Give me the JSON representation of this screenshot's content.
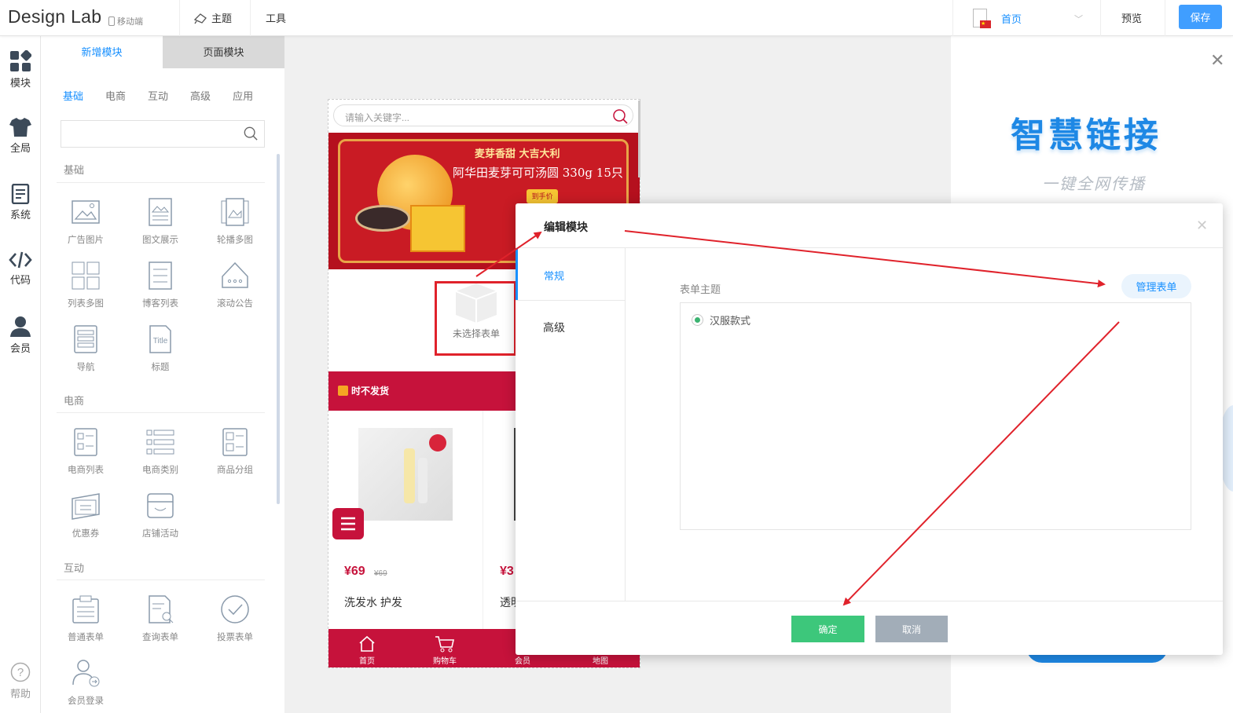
{
  "app": {
    "logo": "Design Lab",
    "device": "移动端"
  },
  "topbar": {
    "menu": [
      {
        "label": "主题",
        "icon": "theme-icon"
      },
      {
        "label": "工具"
      }
    ],
    "current_page": "首页",
    "preview": "预览",
    "save": "保存"
  },
  "sidebar": {
    "items": [
      {
        "label": "模块",
        "icon": "modules-icon"
      },
      {
        "label": "全局",
        "icon": "shirt-icon"
      },
      {
        "label": "系统",
        "icon": "document-icon"
      },
      {
        "label": "代码",
        "icon": "code-icon"
      },
      {
        "label": "会员",
        "icon": "user-icon"
      }
    ],
    "help": "帮助"
  },
  "panel": {
    "tabs": [
      "新增模块",
      "页面模块"
    ],
    "categories": [
      "基础",
      "电商",
      "互动",
      "高级",
      "应用"
    ],
    "sections": [
      {
        "title": "基础",
        "modules": [
          "广告图片",
          "图文展示",
          "轮播多图",
          "列表多图",
          "博客列表",
          "滚动公告",
          "导航",
          "标题"
        ]
      },
      {
        "title": "电商",
        "modules": [
          "电商列表",
          "电商类别",
          "商品分组",
          "优惠券",
          "店铺活动"
        ]
      },
      {
        "title": "互动",
        "modules": [
          "普通表单",
          "查询表单",
          "投票表单",
          "会员登录"
        ]
      }
    ]
  },
  "phone": {
    "search_placeholder": "请输入关键字...",
    "banner": {
      "slogan": "麦芽香甜 大吉大利",
      "product": "阿华田麦芽可可汤圆 330g 15只",
      "tag": "到手价"
    },
    "form_empty": "未选择表单",
    "notice": "时不发货",
    "product": {
      "price": "¥69",
      "old_price": "¥69",
      "name": "洗发水 护发",
      "price2": "¥3",
      "name2": "透明"
    },
    "tabbar": [
      "首页",
      "购物车",
      "会员",
      "地图"
    ]
  },
  "right_panel": {
    "title": "智慧链接",
    "subtitle": "一键全网传播"
  },
  "modal": {
    "title": "编辑模块",
    "tabs": [
      "常规",
      "高级"
    ],
    "form_theme_label": "表单主题",
    "manage_button": "管理表单",
    "options": [
      {
        "label": "汉服款式",
        "selected": true
      }
    ],
    "ok": "确定",
    "cancel": "取消"
  },
  "colors": {
    "accent": "#1890ff",
    "save": "#409eff",
    "brand_red": "#c6123b",
    "ok": "#3dc77b",
    "cancel": "#a2adb8",
    "annotation": "#e0222b"
  }
}
